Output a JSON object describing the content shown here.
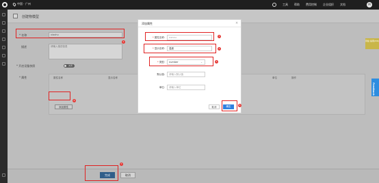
{
  "topbar": {
    "city": "中国 · 广州",
    "nav": [
      "工具",
      "帮助",
      "费用控制",
      "企业组织",
      "文档"
    ],
    "avatar_initial": "M"
  },
  "page": {
    "title": "创建物模型"
  },
  "form": {
    "name_label": "* 名称",
    "name_value": "xiaohu",
    "desc_label": "描述",
    "desc_placeholder": "请输入描述信息",
    "toggle_label": "* 开启设备快照",
    "toggle_text": "关闭",
    "attr_label": "* 属性",
    "table_headers": [
      "属性名称",
      "显示名称",
      "类型",
      "默认值",
      "单位",
      "操作"
    ],
    "add_attr_label": "添加属性"
  },
  "footer": {
    "save_label": "完成",
    "cancel_label": "取消"
  },
  "dialog": {
    "title": "添加属性",
    "close_symbol": "×",
    "fields": {
      "attr_name_label": "属性名称:",
      "attr_name_value": "nxnxu",
      "display_name_label": "显示名称:",
      "display_name_value": "温度",
      "type_label": "类型:",
      "type_value": "number",
      "default_label": "默认值:",
      "default_placeholder": "请输入默认值",
      "unit_label": "单位:",
      "unit_placeholder": "请输入单位"
    },
    "cancel_label": "取消",
    "ok_label": "确定"
  },
  "badges": [
    "1",
    "2",
    "3",
    "4",
    "5",
    "6",
    "7"
  ],
  "right_chip_label": "待续\n指南(MR)",
  "feedback_label": "Feedback",
  "colors": {
    "primary": "#2f7fe0",
    "highlight_box": "#e02020",
    "badge": "#e53935",
    "feedback": "#2d8de0"
  }
}
